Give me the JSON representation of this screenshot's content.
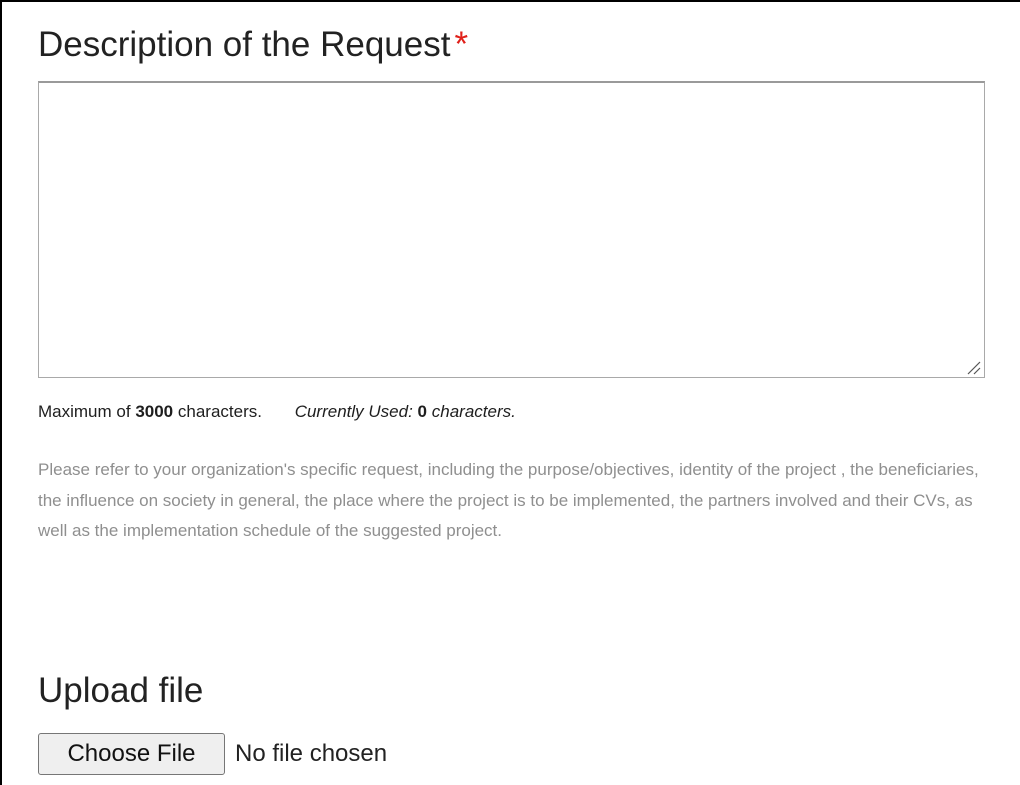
{
  "description_field": {
    "heading": "Description of the Request",
    "required_marker": "*",
    "value": "",
    "counter": {
      "max_prefix": "Maximum of",
      "max_value": "3000",
      "max_suffix": "characters.",
      "used_prefix": "Currently Used:",
      "used_value": "0",
      "used_suffix": "characters."
    },
    "help_text": "Please refer to your organization's specific request, including the purpose/objectives, identity of the project , the beneficiaries, the influence on society in general, the place where the project is to be implemented, the partners involved and their CVs, as well as the implementation schedule of the suggested project."
  },
  "upload": {
    "heading": "Upload file",
    "button_label": "Choose File",
    "status": "No file chosen"
  },
  "colors": {
    "required": "#e0201a",
    "help_text": "#8f8f8f",
    "button_bg": "#efefef"
  }
}
